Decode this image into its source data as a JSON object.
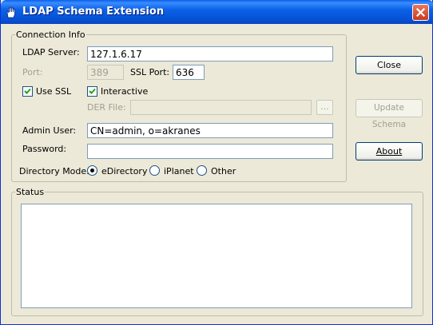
{
  "window": {
    "title": "LDAP Schema Extension",
    "app_icon": "hand-icon",
    "close_icon": "close-icon"
  },
  "connection": {
    "group_label": "Connection Info",
    "server_label": "LDAP Server:",
    "server_value": "127.1.6.17",
    "port_label": "Port:",
    "port_value": "389",
    "ssl_port_label": "SSL Port:",
    "ssl_port_value": "636",
    "use_ssl_label": "Use SSL",
    "use_ssl_checked": true,
    "interactive_label": "Interactive",
    "interactive_checked": true,
    "der_label": "DER File:",
    "der_value": "",
    "browse_label": "...",
    "admin_label": "Admin User:",
    "admin_value": "CN=admin, o=akranes",
    "password_label": "Password:",
    "password_value": "",
    "mode_label": "Directory Mode:",
    "modes": [
      {
        "label": "eDirectory",
        "selected": true
      },
      {
        "label": "iPlanet",
        "selected": false
      },
      {
        "label": "Other",
        "selected": false
      }
    ]
  },
  "buttons": {
    "close": "Close",
    "update_schema": "Update Schema",
    "about": "About"
  },
  "status": {
    "group_label": "Status",
    "text": ""
  },
  "colors": {
    "title_bar": "#0651d6",
    "window_bg": "#ece9d8",
    "close_button": "#c83b1b"
  }
}
